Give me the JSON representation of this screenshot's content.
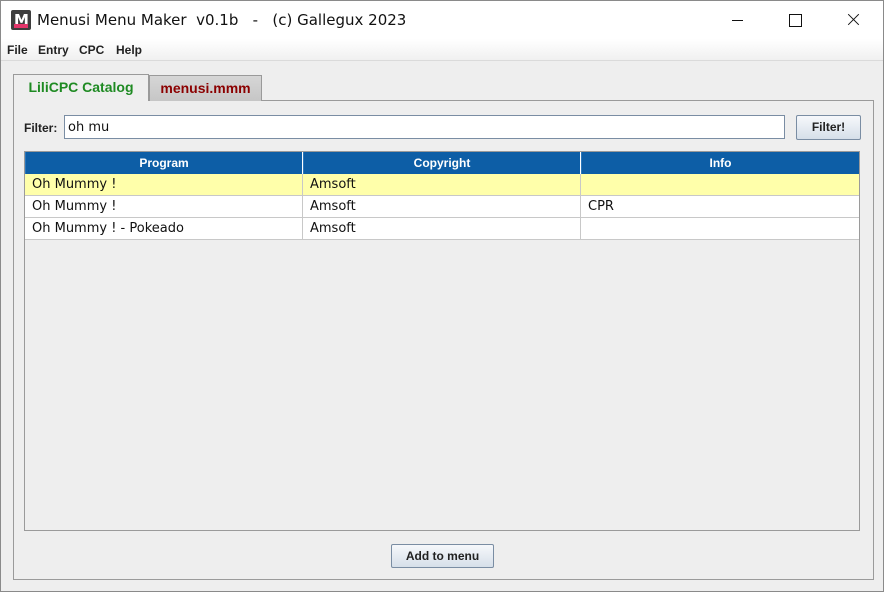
{
  "window": {
    "title": "Menusi Menu Maker  v0.1b   -   (c) Gallegux 2023",
    "icon": "app-m-icon"
  },
  "menu": [
    "File",
    "Entry",
    "CPC",
    "Help"
  ],
  "tabs": [
    {
      "label": "LiliCPC Catalog",
      "active": true,
      "color": "#1e8a22"
    },
    {
      "label": "menusi.mmm",
      "active": false,
      "color": "#8b0000"
    }
  ],
  "filter": {
    "label": "Filter:",
    "value": "oh mu",
    "button": "Filter!"
  },
  "table": {
    "header_color": "#0d5ea6",
    "selected_row_color": "#ffffaa",
    "columns": [
      "Program",
      "Copyright",
      "Info"
    ],
    "rows": [
      {
        "program": "Oh Mummy !",
        "copyright": "Amsoft",
        "info": "",
        "selected": true
      },
      {
        "program": "Oh Mummy !",
        "copyright": "Amsoft",
        "info": "CPR",
        "selected": false
      },
      {
        "program": "Oh Mummy ! - Pokeado",
        "copyright": "Amsoft",
        "info": "",
        "selected": false
      }
    ]
  },
  "actions": {
    "add_to_menu": "Add to menu"
  }
}
